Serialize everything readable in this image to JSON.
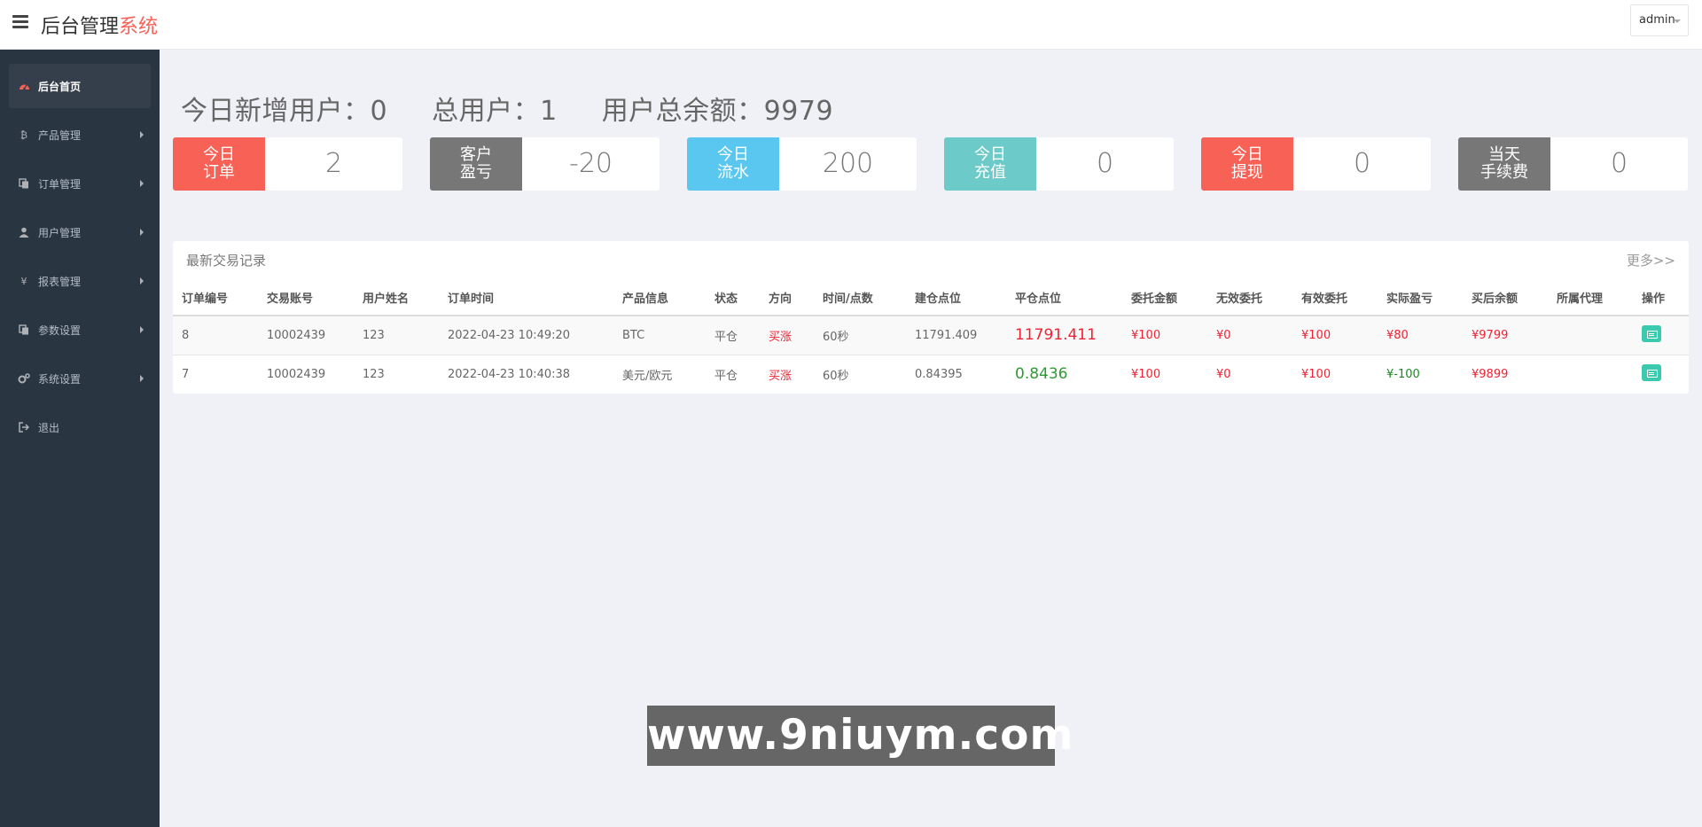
{
  "header": {
    "brand_main": "后台管理",
    "brand_accent": "系统",
    "user": "admin"
  },
  "sidebar": {
    "items": [
      {
        "label": "后台首页",
        "icon": "dashboard-icon"
      },
      {
        "label": "产品管理",
        "icon": "bitcoin-icon"
      },
      {
        "label": "订单管理",
        "icon": "copy-icon"
      },
      {
        "label": "用户管理",
        "icon": "user-icon"
      },
      {
        "label": "报表管理",
        "icon": "yen-icon"
      },
      {
        "label": "参数设置",
        "icon": "copy-icon"
      },
      {
        "label": "系统设置",
        "icon": "cogs-icon"
      },
      {
        "label": "退出",
        "icon": "sign-out-icon"
      }
    ]
  },
  "summary": {
    "new_users": "今日新增用户：0",
    "total_users": "总用户：1",
    "total_balance": "用户总余额：9979"
  },
  "stats": [
    {
      "line1": "今日",
      "line2": "订单",
      "value": "2",
      "color": "#f86155"
    },
    {
      "line1": "客户",
      "line2": "盈亏",
      "value": "-20",
      "color": "#777777"
    },
    {
      "line1": "今日",
      "line2": "流水",
      "value": "200",
      "color": "#59c7ef"
    },
    {
      "line1": "今日",
      "line2": "充值",
      "value": "0",
      "color": "#6ccac9"
    },
    {
      "line1": "今日",
      "line2": "提现",
      "value": "0",
      "color": "#f86155"
    },
    {
      "line1": "当天",
      "line2": "手续费",
      "value": "0",
      "color": "#777777"
    }
  ],
  "panel": {
    "title": "最新交易记录",
    "more": "更多>>"
  },
  "table": {
    "headers": [
      "订单编号",
      "交易账号",
      "用户姓名",
      "订单时间",
      "产品信息",
      "状态",
      "方向",
      "时间/点数",
      "建仓点位",
      "平仓点位",
      "委托金额",
      "无效委托",
      "有效委托",
      "实际盈亏",
      "买后余额",
      "所属代理",
      "操作"
    ],
    "rows": [
      {
        "id": "8",
        "account": "10002439",
        "name": "123",
        "time": "2022-04-23 10:49:20",
        "product": "BTC",
        "status": "平仓",
        "direction": "买涨",
        "duration": "60秒",
        "open": "11791.409",
        "close": "11791.411",
        "amount": "¥100",
        "invalid": "¥0",
        "valid": "¥100",
        "pnl": "¥80",
        "balance": "¥9799",
        "agent": ""
      },
      {
        "id": "7",
        "account": "10002439",
        "name": "123",
        "time": "2022-04-23 10:40:38",
        "product": "美元/欧元",
        "status": "平仓",
        "direction": "买涨",
        "duration": "60秒",
        "open": "0.84395",
        "close": "0.8436",
        "amount": "¥100",
        "invalid": "¥0",
        "valid": "¥100",
        "pnl": "¥-100",
        "balance": "¥9899",
        "agent": ""
      }
    ]
  },
  "watermark": "www.9niuym.com"
}
